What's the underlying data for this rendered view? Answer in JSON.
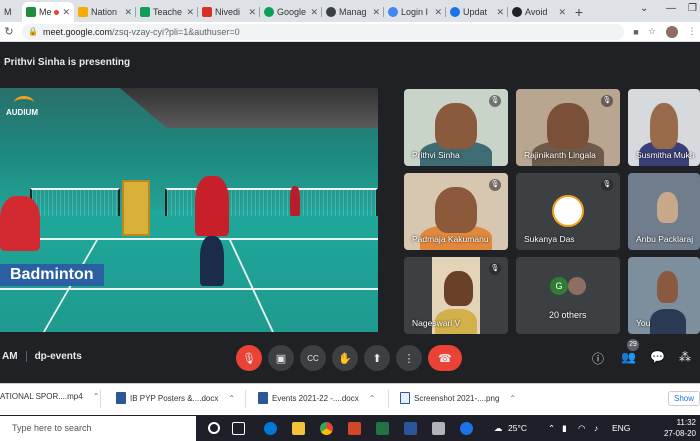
{
  "browser": {
    "tabs": [
      {
        "label": "Me",
        "color": "#1e8e3e",
        "active": true
      },
      {
        "label": "Nation",
        "color": "#f9ab00"
      },
      {
        "label": "Teache",
        "color": "#0f9d58"
      },
      {
        "label": "Nivedi",
        "color": "#d93025"
      },
      {
        "label": "Google",
        "color": "#0f9d58"
      },
      {
        "label": "Manag",
        "color": "#3c4043"
      },
      {
        "label": "Login I",
        "color": "#4285f4"
      },
      {
        "label": "Updat",
        "color": "#1a73e8"
      },
      {
        "label": "Avoid",
        "color": "#202124"
      }
    ],
    "url_host": "meet.google.com",
    "url_path": "/zsq-vzay-cyi?pli=1&authuser=0",
    "new_tab": "+"
  },
  "meeting": {
    "presenter_text": "Prithvi Sinha is presenting",
    "slide_caption": "Badminton",
    "slide_logo": "AUDIUM",
    "meeting_code_prefix": "AM",
    "meeting_name": "dp-events",
    "participant_count": "29"
  },
  "participants": [
    {
      "name": "Prithvi Sinha",
      "muted": true
    },
    {
      "name": "Rajinikanth Lingala",
      "muted": true
    },
    {
      "name": "Susmitha Mukh",
      "muted": false
    },
    {
      "name": "Padmaja Kakumanu",
      "muted": true
    },
    {
      "name": "Sukanya Das",
      "muted": true
    },
    {
      "name": "Anbu Packlaraj",
      "muted": false
    },
    {
      "name": "Nageswari V",
      "muted": true
    },
    {
      "name": "20 others",
      "muted": false
    },
    {
      "name": "You",
      "muted": false
    }
  ],
  "others_avatar_letter": "G",
  "downloads": [
    {
      "name": "ATIONAL SPOR....mp4",
      "color": "#5f6368"
    },
    {
      "name": "IB PYP Posters &....docx",
      "color": "#2b579a"
    },
    {
      "name": "Events 2021-22 -....docx",
      "color": "#2b579a"
    },
    {
      "name": "Screenshot 2021-....png",
      "color": "#2b579a"
    }
  ],
  "downloads_show_all": "Show",
  "taskbar": {
    "search_placeholder": "Type here to search",
    "temperature": "25°C",
    "language": "ENG",
    "time": "11:32",
    "date": "27-08-20"
  },
  "colors": {
    "meet_bg": "#202124",
    "tile_bg": "#3c4043",
    "end_call": "#ea4335",
    "banner": "#2b5fa3"
  }
}
